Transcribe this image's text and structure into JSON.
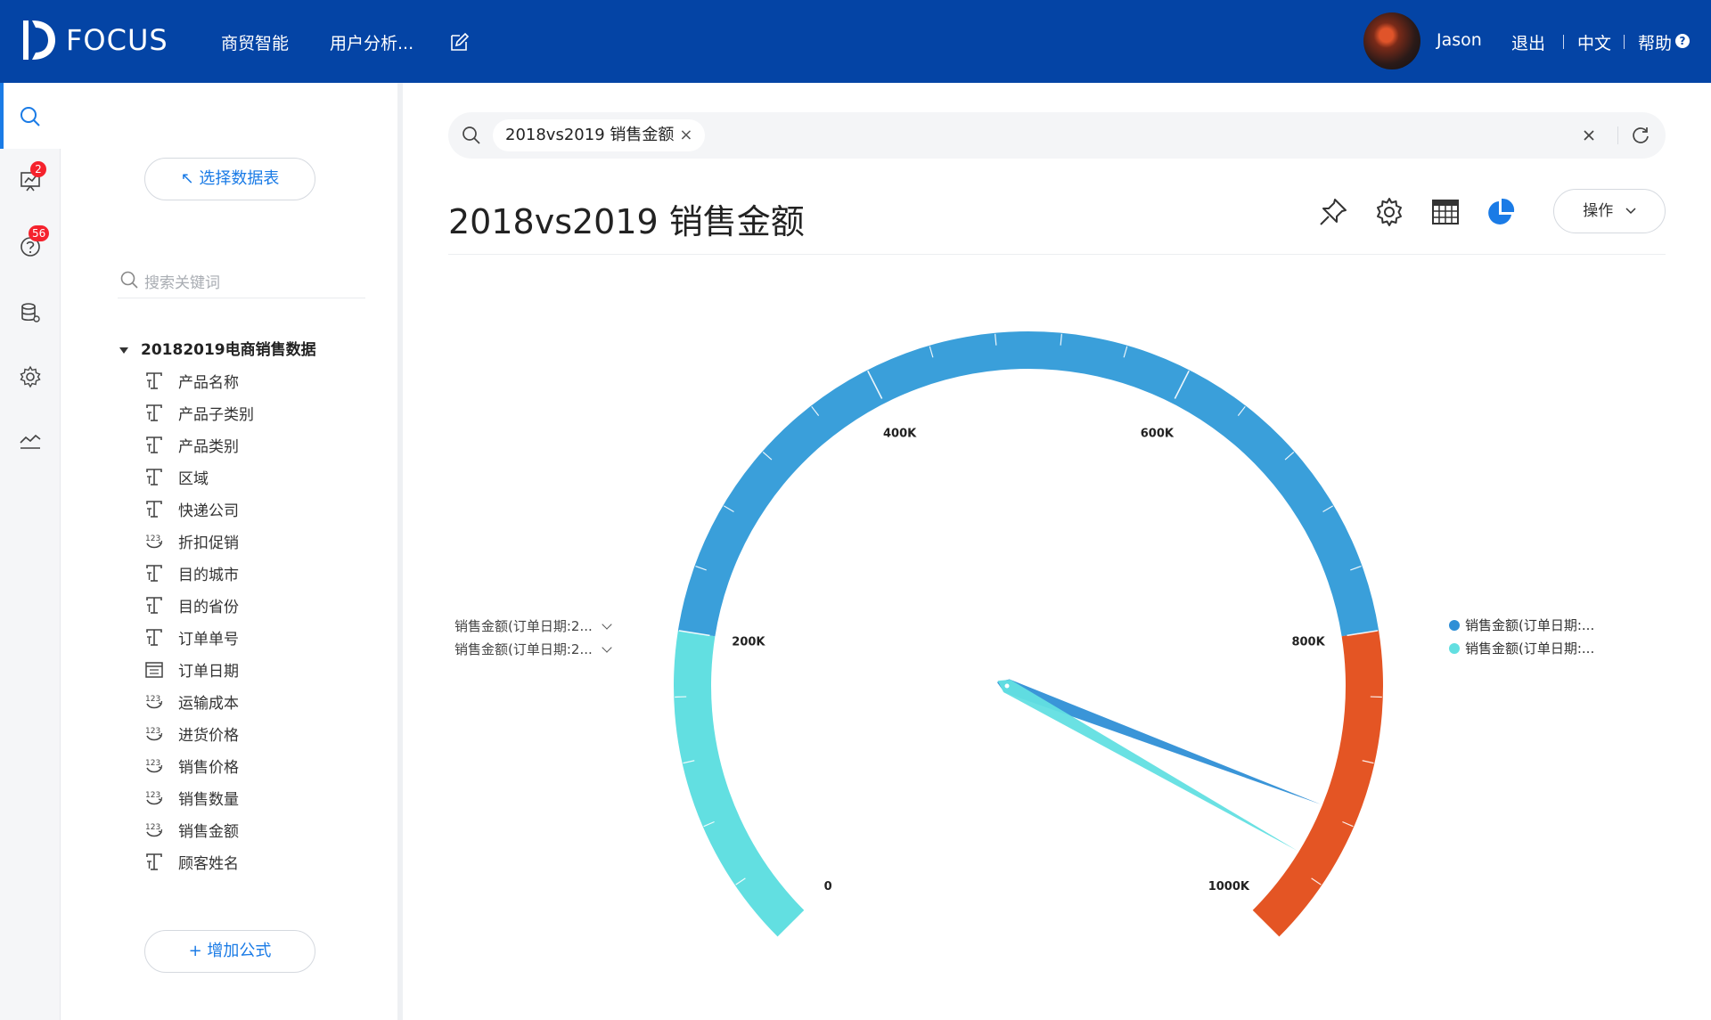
{
  "app": {
    "brand": "FOCUS",
    "nav": [
      "商贸智能",
      "用户分析..."
    ],
    "user": "Jason",
    "logout": "退出",
    "language": "中文",
    "help": "帮助",
    "help_glyph": "?"
  },
  "rail": {
    "badges": {
      "messages": "2",
      "questions": "56"
    }
  },
  "panel": {
    "select_table": "↖ 选择数据表",
    "search_placeholder": "搜索关键词",
    "dataset": "20182019电商销售数据",
    "fields": [
      {
        "label": "产品名称",
        "icon": "text-column-icon"
      },
      {
        "label": "产品子类别",
        "icon": "text-column-icon"
      },
      {
        "label": "产品类别",
        "icon": "text-column-icon"
      },
      {
        "label": "区域",
        "icon": "text-column-icon"
      },
      {
        "label": "快递公司",
        "icon": "text-column-icon"
      },
      {
        "label": "折扣促销",
        "icon": "number-column-icon"
      },
      {
        "label": "目的城市",
        "icon": "text-column-icon"
      },
      {
        "label": "目的省份",
        "icon": "text-column-icon"
      },
      {
        "label": "订单单号",
        "icon": "text-column-icon"
      },
      {
        "label": "订单日期",
        "icon": "date-column-icon"
      },
      {
        "label": "运输成本",
        "icon": "number-column-icon"
      },
      {
        "label": "进货价格",
        "icon": "number-column-icon"
      },
      {
        "label": "销售价格",
        "icon": "number-column-icon"
      },
      {
        "label": "销售数量",
        "icon": "number-column-icon"
      },
      {
        "label": "销售金额",
        "icon": "number-column-icon"
      },
      {
        "label": "顾客姓名",
        "icon": "text-column-icon"
      }
    ],
    "add_formula": "+ 增加公式"
  },
  "search": {
    "token": "2018vs2019  销售金额",
    "token_close": "×"
  },
  "header": {
    "title": "2018vs2019 销售金额",
    "ops": "操作"
  },
  "chart_data": {
    "type": "gauge",
    "min": 0,
    "max": 1000000,
    "tick_labels": [
      "0",
      "200K",
      "400K",
      "600K",
      "800K",
      "1000K"
    ],
    "tick_values": [
      0,
      200000,
      400000,
      600000,
      800000,
      1000000
    ],
    "bands": [
      {
        "from": 0,
        "to": 200000,
        "color": "#62dfe1"
      },
      {
        "from": 200000,
        "to": 800000,
        "color": "#3a9fda"
      },
      {
        "from": 800000,
        "to": 1000000,
        "color": "#e45524"
      }
    ],
    "dropdowns": [
      "销售金额(订单日期:2...",
      "销售金额(订单日期:2..."
    ],
    "legend": [
      {
        "label": "销售金额(订单日期:...",
        "color": "#2f8fd6"
      },
      {
        "label": "销售金额(订单日期:...",
        "color": "#62dfe1"
      }
    ],
    "series": [
      {
        "values": [
          915000
        ],
        "color": "#2f8fd6"
      },
      {
        "values": [
          950000
        ],
        "color": "#62dfe1"
      }
    ]
  }
}
